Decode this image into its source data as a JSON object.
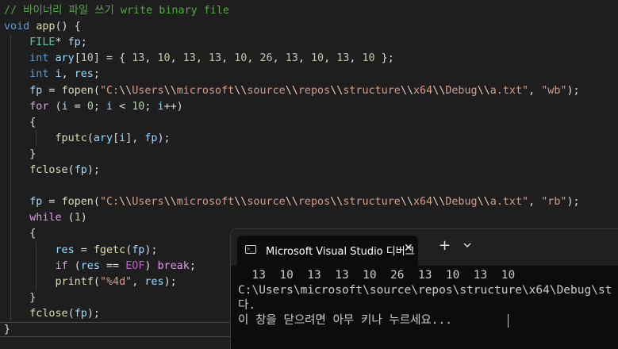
{
  "editor": {
    "lines": [
      [
        [
          "c-comment",
          "// 바이너리 파일 쓰기 write binary file"
        ]
      ],
      [
        [
          "c-kw",
          "void"
        ],
        [
          "c-punc",
          " "
        ],
        [
          "c-fn",
          "app"
        ],
        [
          "c-punc",
          "() {"
        ]
      ],
      [
        [
          "c-punc",
          "    "
        ],
        [
          "c-type",
          "FILE"
        ],
        [
          "c-punc",
          "* "
        ],
        [
          "c-var",
          "fp"
        ],
        [
          "c-punc",
          ";"
        ]
      ],
      [
        [
          "c-punc",
          "    "
        ],
        [
          "c-kw",
          "int"
        ],
        [
          "c-punc",
          " "
        ],
        [
          "c-var",
          "ary"
        ],
        [
          "c-punc",
          "["
        ],
        [
          "c-num",
          "10"
        ],
        [
          "c-punc",
          "] = { "
        ],
        [
          "c-num",
          "13"
        ],
        [
          "c-punc",
          ", "
        ],
        [
          "c-num",
          "10"
        ],
        [
          "c-punc",
          ", "
        ],
        [
          "c-num",
          "13"
        ],
        [
          "c-punc",
          ", "
        ],
        [
          "c-num",
          "13"
        ],
        [
          "c-punc",
          ", "
        ],
        [
          "c-num",
          "10"
        ],
        [
          "c-punc",
          ", "
        ],
        [
          "c-num",
          "26"
        ],
        [
          "c-punc",
          ", "
        ],
        [
          "c-num",
          "13"
        ],
        [
          "c-punc",
          ", "
        ],
        [
          "c-num",
          "10"
        ],
        [
          "c-punc",
          ", "
        ],
        [
          "c-num",
          "13"
        ],
        [
          "c-punc",
          ", "
        ],
        [
          "c-num",
          "10"
        ],
        [
          "c-punc",
          " };"
        ]
      ],
      [
        [
          "c-punc",
          "    "
        ],
        [
          "c-kw",
          "int"
        ],
        [
          "c-punc",
          " "
        ],
        [
          "c-var",
          "i"
        ],
        [
          "c-punc",
          ", "
        ],
        [
          "c-var",
          "res"
        ],
        [
          "c-punc",
          ";"
        ]
      ],
      [
        [
          "c-punc",
          "    "
        ],
        [
          "c-var",
          "fp"
        ],
        [
          "c-punc",
          " = "
        ],
        [
          "c-fn",
          "fopen"
        ],
        [
          "c-punc",
          "("
        ],
        [
          "c-str",
          "\"C:"
        ],
        [
          "c-esc",
          "\\\\"
        ],
        [
          "c-str",
          "Users"
        ],
        [
          "c-esc",
          "\\\\"
        ],
        [
          "c-str",
          "microsoft"
        ],
        [
          "c-esc",
          "\\\\"
        ],
        [
          "c-str",
          "source"
        ],
        [
          "c-esc",
          "\\\\"
        ],
        [
          "c-str",
          "repos"
        ],
        [
          "c-esc",
          "\\\\"
        ],
        [
          "c-str",
          "structure"
        ],
        [
          "c-esc",
          "\\\\"
        ],
        [
          "c-str",
          "x64"
        ],
        [
          "c-esc",
          "\\\\"
        ],
        [
          "c-str",
          "Debug"
        ],
        [
          "c-esc",
          "\\\\"
        ],
        [
          "c-str",
          "a.txt\""
        ],
        [
          "c-punc",
          ", "
        ],
        [
          "c-str",
          "\"wb\""
        ],
        [
          "c-punc",
          ");"
        ]
      ],
      [
        [
          "c-punc",
          "    "
        ],
        [
          "c-ctrl",
          "for"
        ],
        [
          "c-punc",
          " ("
        ],
        [
          "c-var",
          "i"
        ],
        [
          "c-punc",
          " = "
        ],
        [
          "c-num",
          "0"
        ],
        [
          "c-punc",
          "; "
        ],
        [
          "c-var",
          "i"
        ],
        [
          "c-punc",
          " < "
        ],
        [
          "c-num",
          "10"
        ],
        [
          "c-punc",
          "; "
        ],
        [
          "c-var",
          "i"
        ],
        [
          "c-punc",
          "++)"
        ]
      ],
      [
        [
          "c-punc",
          "    {"
        ]
      ],
      [
        [
          "c-punc",
          "        "
        ],
        [
          "c-fn",
          "fputc"
        ],
        [
          "c-punc",
          "("
        ],
        [
          "c-var",
          "ary"
        ],
        [
          "c-punc",
          "["
        ],
        [
          "c-var",
          "i"
        ],
        [
          "c-punc",
          "], "
        ],
        [
          "c-var",
          "fp"
        ],
        [
          "c-punc",
          ");"
        ]
      ],
      [
        [
          "c-punc",
          "    }"
        ]
      ],
      [
        [
          "c-punc",
          "    "
        ],
        [
          "c-fn",
          "fclose"
        ],
        [
          "c-punc",
          "("
        ],
        [
          "c-var",
          "fp"
        ],
        [
          "c-punc",
          ");"
        ]
      ],
      [
        [
          "c-punc",
          ""
        ]
      ],
      [
        [
          "c-punc",
          "    "
        ],
        [
          "c-var",
          "fp"
        ],
        [
          "c-punc",
          " = "
        ],
        [
          "c-fn",
          "fopen"
        ],
        [
          "c-punc",
          "("
        ],
        [
          "c-str",
          "\"C:"
        ],
        [
          "c-esc",
          "\\\\"
        ],
        [
          "c-str",
          "Users"
        ],
        [
          "c-esc",
          "\\\\"
        ],
        [
          "c-str",
          "microsoft"
        ],
        [
          "c-esc",
          "\\\\"
        ],
        [
          "c-str",
          "source"
        ],
        [
          "c-esc",
          "\\\\"
        ],
        [
          "c-str",
          "repos"
        ],
        [
          "c-esc",
          "\\\\"
        ],
        [
          "c-str",
          "structure"
        ],
        [
          "c-esc",
          "\\\\"
        ],
        [
          "c-str",
          "x64"
        ],
        [
          "c-esc",
          "\\\\"
        ],
        [
          "c-str",
          "Debug"
        ],
        [
          "c-esc",
          "\\\\"
        ],
        [
          "c-str",
          "a.txt\""
        ],
        [
          "c-punc",
          ", "
        ],
        [
          "c-str",
          "\"rb\""
        ],
        [
          "c-punc",
          ");"
        ]
      ],
      [
        [
          "c-punc",
          "    "
        ],
        [
          "c-ctrl",
          "while"
        ],
        [
          "c-punc",
          " ("
        ],
        [
          "c-num",
          "1"
        ],
        [
          "c-punc",
          ")"
        ]
      ],
      [
        [
          "c-punc",
          "    {"
        ]
      ],
      [
        [
          "c-punc",
          "        "
        ],
        [
          "c-var",
          "res"
        ],
        [
          "c-punc",
          " = "
        ],
        [
          "c-fn",
          "fgetc"
        ],
        [
          "c-punc",
          "("
        ],
        [
          "c-var",
          "fp"
        ],
        [
          "c-punc",
          ");"
        ]
      ],
      [
        [
          "c-punc",
          "        "
        ],
        [
          "c-ctrl",
          "if"
        ],
        [
          "c-punc",
          " ("
        ],
        [
          "c-var",
          "res"
        ],
        [
          "c-punc",
          " == "
        ],
        [
          "c-macro",
          "EOF"
        ],
        [
          "c-punc",
          ") "
        ],
        [
          "c-ctrl",
          "break"
        ],
        [
          "c-punc",
          ";"
        ]
      ],
      [
        [
          "c-punc",
          "        "
        ],
        [
          "c-fn",
          "printf"
        ],
        [
          "c-punc",
          "("
        ],
        [
          "c-str",
          "\"%4d\""
        ],
        [
          "c-punc",
          ", "
        ],
        [
          "c-var",
          "res"
        ],
        [
          "c-punc",
          ");"
        ]
      ],
      [
        [
          "c-punc",
          "    }"
        ]
      ],
      [
        [
          "c-punc",
          "    "
        ],
        [
          "c-fn",
          "fclose"
        ],
        [
          "c-punc",
          "("
        ],
        [
          "c-var",
          "fp"
        ],
        [
          "c-punc",
          ");"
        ]
      ],
      [
        [
          "c-punc",
          "}"
        ]
      ]
    ]
  },
  "console": {
    "tab_title": "Microsoft Visual Studio 디버그",
    "tab_close": "✕",
    "new_tab": "+",
    "output": [
      "  13  10  13  13  10  26  13  10  13  10",
      "C:\\Users\\microsoft\\source\\repos\\structure\\x64\\Debug\\st",
      "다.",
      "이 창을 닫으려면 아무 키나 누르세요..."
    ]
  }
}
